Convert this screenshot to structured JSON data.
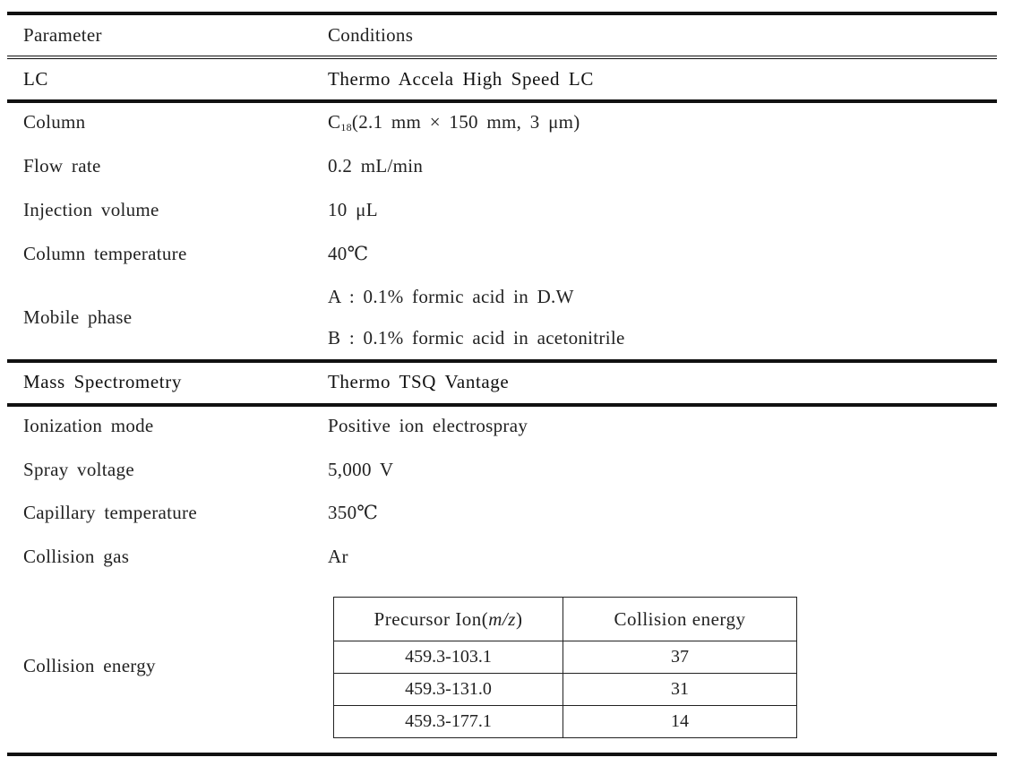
{
  "header": {
    "parameter": "Parameter",
    "conditions": "Conditions"
  },
  "lc": {
    "section": "LC",
    "instrument": "Thermo Accela High Speed LC",
    "rows": [
      {
        "param": "Column",
        "value_prefix": "C",
        "value_sub": "18",
        "value_rest": "(2.1 mm × 150 mm, 3 μm)"
      },
      {
        "param": "Flow rate",
        "value": "0.2 mL/min"
      },
      {
        "param": "Injection volume",
        "value": "10 μL"
      },
      {
        "param": "Column temperature",
        "value": "40℃"
      }
    ],
    "mobile_phase": {
      "param": "Mobile phase",
      "a": "A : 0.1% formic acid in D.W",
      "b": "B : 0.1% formic acid in acetonitrile"
    }
  },
  "ms": {
    "section": "Mass Spectrometry",
    "instrument": "Thermo TSQ Vantage",
    "rows": [
      {
        "param": "Ionization mode",
        "value": "Positive ion electrospray"
      },
      {
        "param": "Spray voltage",
        "value": "5,000 V"
      },
      {
        "param": "Capillary temperature",
        "value": "350℃"
      },
      {
        "param": "Collision gas",
        "value": "Ar"
      }
    ],
    "collision_energy": {
      "param": "Collision energy",
      "col1_prefix": "Precursor Ion(",
      "col1_italic": "m/z",
      "col1_suffix": ")",
      "col2": "Collision energy",
      "rows": [
        {
          "ion": "459.3-103.1",
          "energy": "37"
        },
        {
          "ion": "459.3-131.0",
          "energy": "31"
        },
        {
          "ion": "459.3-177.1",
          "energy": "14"
        }
      ]
    }
  }
}
